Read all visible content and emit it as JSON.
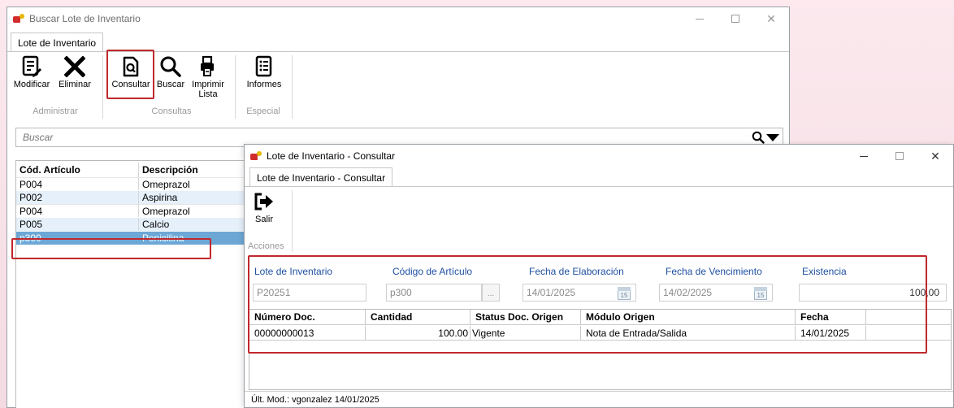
{
  "main_window": {
    "title": "Buscar Lote de Inventario",
    "tab": "Lote de Inventario",
    "ribbon": {
      "groups": [
        {
          "label": "Administrar",
          "buttons": [
            {
              "label": "Modificar"
            },
            {
              "label": "Eliminar"
            }
          ]
        },
        {
          "label": "Consultas",
          "buttons": [
            {
              "label": "Consultar"
            },
            {
              "label": "Buscar"
            },
            {
              "label": "Imprimir Lista"
            }
          ]
        },
        {
          "label": "Especial",
          "buttons": [
            {
              "label": "Informes"
            }
          ]
        }
      ]
    },
    "search": {
      "placeholder": "Buscar"
    },
    "grid": {
      "columns": [
        "Cód. Artículo",
        "Descripción"
      ],
      "rows": [
        {
          "codigo": "P004",
          "descripcion": "Omeprazol"
        },
        {
          "codigo": "P002",
          "descripcion": "Aspirina"
        },
        {
          "codigo": "P004",
          "descripcion": "Omeprazol"
        },
        {
          "codigo": "P005",
          "descripcion": "Calcio"
        },
        {
          "codigo": "p300",
          "descripcion": "Penicilina"
        }
      ],
      "selected_index": 4
    }
  },
  "consult_window": {
    "title": "Lote de Inventario - Consultar",
    "tab": "Lote de Inventario - Consultar",
    "ribbon": {
      "group_label": "Acciones",
      "button_label": "Salir"
    },
    "fields": {
      "lote": {
        "label": "Lote de Inventario",
        "value": "P20251"
      },
      "codigo": {
        "label": "Código de Artículo",
        "value": "p300",
        "button": "..."
      },
      "fecha_elab": {
        "label": "Fecha de Elaboración",
        "value": "14/01/2025",
        "cal": "15"
      },
      "fecha_venc": {
        "label": "Fecha de Vencimiento",
        "value": "14/02/2025",
        "cal": "15"
      },
      "existencia": {
        "label": "Existencia",
        "value": "100,00"
      }
    },
    "grid": {
      "columns": [
        "Número Doc.",
        "Cantidad",
        "Status Doc. Origen",
        "Módulo Origen",
        "Fecha"
      ],
      "rows": [
        {
          "numero": "00000000013",
          "cantidad": "100.00",
          "status": "Vigente",
          "modulo": "Nota de Entrada/Salida",
          "fecha": "14/01/2025"
        }
      ]
    },
    "status_bar": "Últ. Mod.: vgonzalez 14/01/2025"
  },
  "colors": {
    "highlight": "#c0282d",
    "selected_row": "#6da7d6",
    "alt_row": "#e6f0fb",
    "label_blue": "#1e4fa3"
  }
}
